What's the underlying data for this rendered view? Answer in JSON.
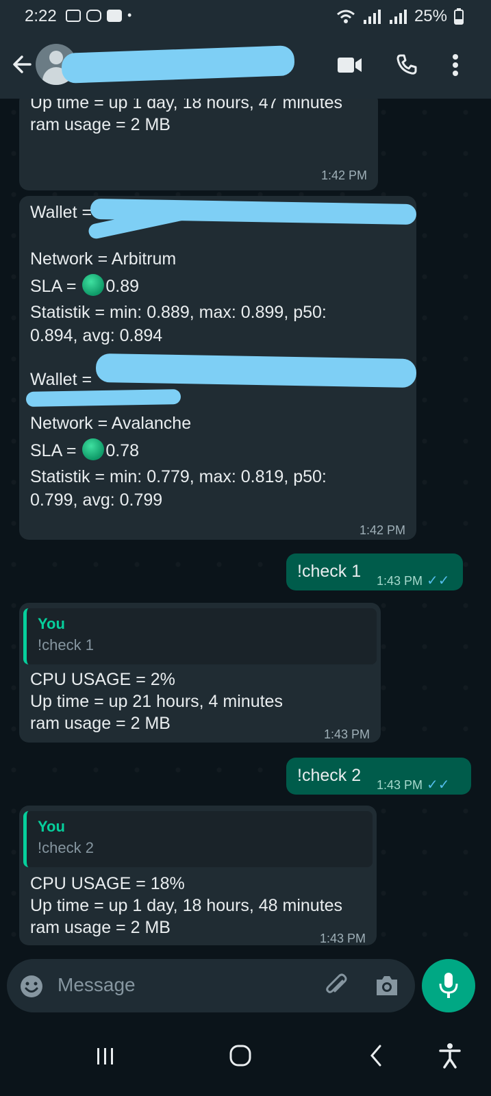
{
  "status_bar": {
    "time": "2:22",
    "battery": "25%"
  },
  "header": {},
  "messages": [
    {
      "lines": [
        "Up time = up 1 day, 18 hours, 47 minutes",
        "ram usage = 2 MB"
      ],
      "time": "1:42 PM"
    },
    {
      "wallets": [
        {
          "wallet_label": "Wallet =",
          "network": "Network = Arbitrum",
          "sla_prefix": "SLA =",
          "sla_value": "0.89",
          "stats1": "Statistik = min: 0.889, max: 0.899, p50:",
          "stats2": "0.894, avg: 0.894"
        },
        {
          "wallet_label": "Wallet =",
          "network": "Network = Avalanche",
          "sla_prefix": "SLA =",
          "sla_value": "0.78",
          "stats1": "Statistik = min: 0.779, max: 0.819, p50:",
          "stats2": "0.799, avg: 0.799"
        }
      ],
      "time": "1:42 PM"
    },
    {
      "outgoing": true,
      "text": "!check 1",
      "time": "1:43 PM"
    },
    {
      "quote_name": "You",
      "quote_text": "!check 1",
      "lines": [
        "CPU USAGE = 2%",
        "Up time = up 21 hours, 4 minutes",
        "ram usage = 2 MB"
      ],
      "time": "1:43 PM"
    },
    {
      "outgoing": true,
      "text": "!check 2",
      "time": "1:43 PM"
    },
    {
      "quote_name": "You",
      "quote_text": "!check 2",
      "lines": [
        "CPU USAGE = 18%",
        "Up time = up 1 day, 18 hours, 48 minutes",
        "ram usage = 2 MB"
      ],
      "time": "1:43 PM"
    }
  ],
  "composer": {
    "placeholder": "Message"
  },
  "colors": {
    "accent": "#00a884",
    "outgoing_bubble": "#005c4b",
    "incoming_bubble": "#202c33",
    "read_ticks": "#53bdeb"
  }
}
